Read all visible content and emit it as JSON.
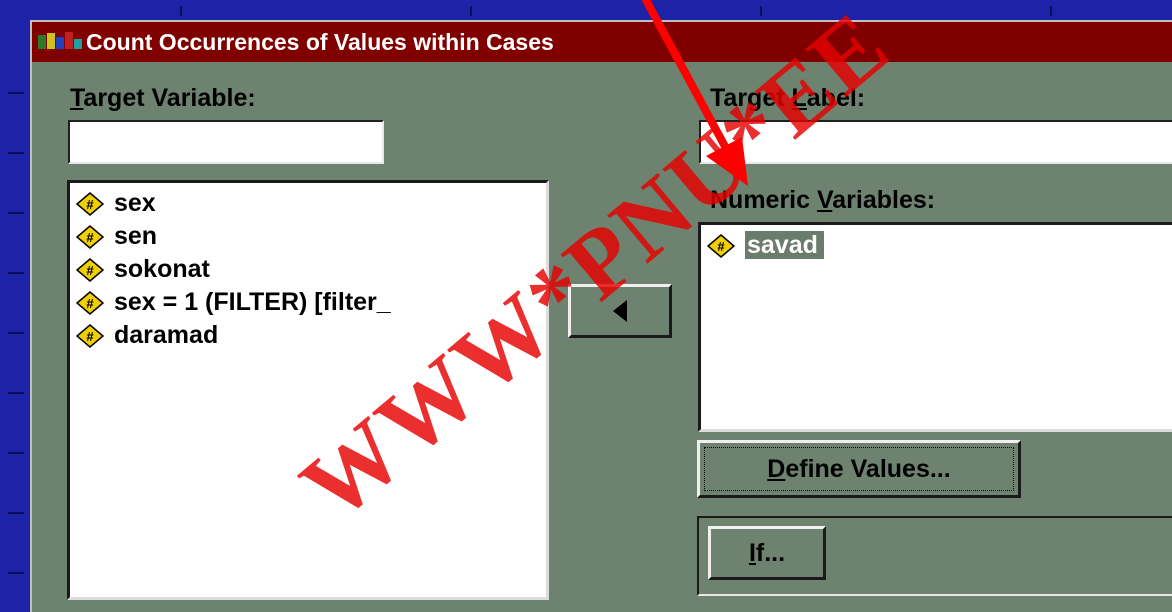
{
  "dialog": {
    "title": "Count Occurrences of Values within Cases",
    "target_variable_label": {
      "key": "T",
      "rest": "arget Variable:"
    },
    "target_variable_value": "",
    "target_label_label": {
      "pre": "Target ",
      "key": "L",
      "rest": "abel:"
    },
    "target_label_value": "",
    "numeric_variables_label": {
      "pre": "Numeric ",
      "key": "V",
      "rest": "ariables:"
    },
    "source_variables": [
      {
        "name": "sex"
      },
      {
        "name": "sen"
      },
      {
        "name": "sokonat"
      },
      {
        "name": "sex = 1 (FILTER) [filter_"
      },
      {
        "name": "daramad"
      }
    ],
    "numeric_variables": [
      {
        "name": "savad",
        "selected": true
      }
    ],
    "move_button_icon": "triangle-left",
    "define_values_button": {
      "key": "D",
      "rest": "efine Values..."
    },
    "if_button": {
      "key": "I",
      "rest": "f..."
    }
  },
  "overlay": {
    "watermark": "WWW*PNU*EE",
    "arrow_color": "#ff0000"
  },
  "colors": {
    "slide_background": "#1d22a6",
    "dialog_face": "#6e8270",
    "titlebar": "#800000",
    "selection": "#6a7c6c"
  }
}
